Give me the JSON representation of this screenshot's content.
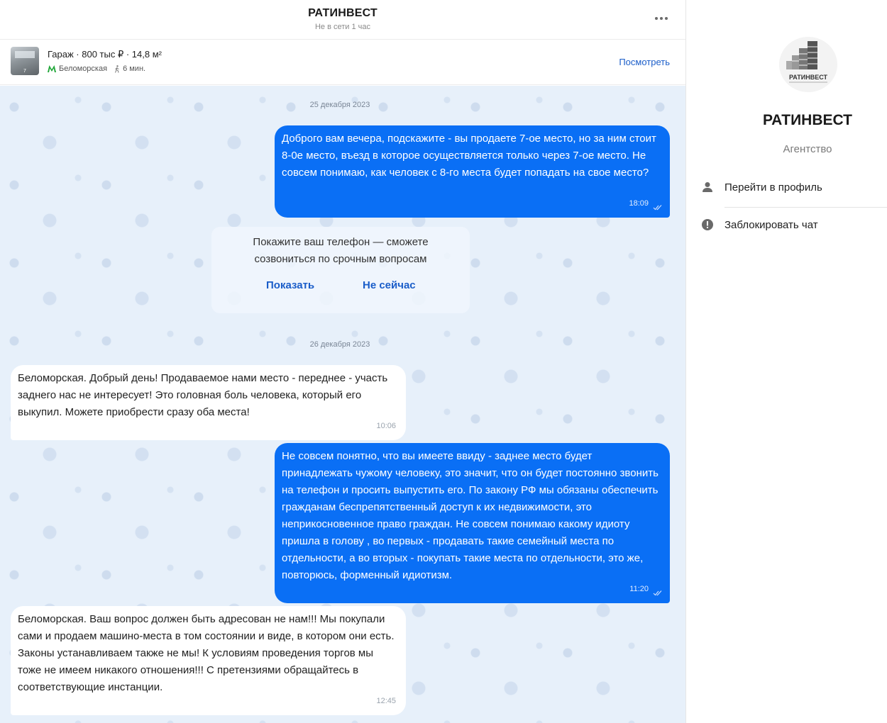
{
  "header": {
    "title": "РАТИНВЕСТ",
    "status": "Не в сети 1 час",
    "more_icon": "more-dots-icon"
  },
  "listing": {
    "thumb_number": "7",
    "summary": "Гараж · 800 тыс ₽ · 14,8 м²",
    "metro": "Беломорская",
    "walk_time": "6 мин.",
    "view_label": "Посмотреть"
  },
  "dates": {
    "first": "25 декабря 2023",
    "second": "26 декабря 2023"
  },
  "messages": [
    {
      "direction": "out",
      "text": "Доброго вам вечера, подскажите - вы продаете 7-ое место, но за ним стоит 8-0е место, въезд в которое осуществляется только через 7-ое место. Не совсем понимаю, как человек с 8-го места будет попадать на свое место?",
      "time": "18:09",
      "read": true
    },
    {
      "direction": "in",
      "text": "Беломорская. Добрый день! Продаваемое нами место - переднее - участь заднего нас не интересует! Это головная боль человека, который его выкупил. Можете приобрести сразу оба места!",
      "time": "10:06"
    },
    {
      "direction": "out",
      "text": "Не совсем понятно, что вы имеете ввиду - заднее место будет принадлежать чужому человеку, это значит, что он будет постоянно звонить на телефон и просить выпустить его. По закону РФ мы обязаны обеспечить гражданам беспрепятственный доступ к их недвижимости, это неприкосновенное право граждан. Не совсем понимаю какому идиоту пришла в голову , во первых - продавать такие семейный места по отдельности, а во вторых - покупать такие места по отдельности, это же, повторюсь, форменный идиотизм.",
      "time": "11:20",
      "read": true
    },
    {
      "direction": "in",
      "text": "Беломорская. Ваш вопрос должен быть адресован не нам!!! Мы покупали сами и продаем машино-места в том состоянии и виде, в котором они есть. Законы устанавливаем также не мы! К условиям проведения торгов мы тоже не имеем никакого отношения!!! С претензиями обращайтесь в соответствующие инстанции.",
      "time": "12:45"
    }
  ],
  "phone_prompt": {
    "text_line1": "Покажите ваш телефон — сможете",
    "text_line2": "созвониться по срочным вопросам",
    "show_label": "Показать",
    "later_label": "Не сейчас"
  },
  "side": {
    "logo_text": "РАТИНВЕСТ",
    "name": "РАТИНВЕСТ",
    "type": "Агентство",
    "profile_label": "Перейти в профиль",
    "profile_icon": "person-icon",
    "block_label": "Заблокировать чат",
    "block_icon": "alert-circle-icon"
  },
  "colors": {
    "outgoing_bubble": "#0a6ff5",
    "incoming_bubble": "#ffffff",
    "chat_background": "#e7f0fa",
    "link": "#1a5dc9",
    "metro": "#1fa637"
  }
}
